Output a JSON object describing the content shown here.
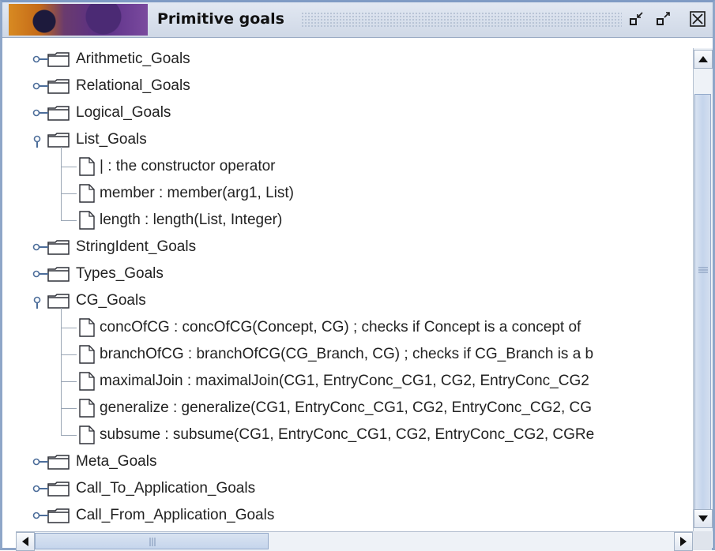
{
  "window": {
    "title": "Primitive goals"
  },
  "colors": {
    "folder_outline": "#2f3138",
    "tree_line": "#9aa6b5",
    "scroll_thumb": "#c5d5ec"
  },
  "tree": {
    "root_items": [
      {
        "label": "Arithmetic_Goals",
        "icon": "folder-icon",
        "expanded": false
      },
      {
        "label": "Relational_Goals",
        "icon": "folder-icon",
        "expanded": false
      },
      {
        "label": "Logical_Goals",
        "icon": "folder-icon",
        "expanded": false
      },
      {
        "label": "List_Goals",
        "icon": "folder-icon",
        "expanded": true,
        "children": [
          {
            "label": "| : the constructor operator",
            "icon": "document-icon"
          },
          {
            "label": "member : member(arg1, List)",
            "icon": "document-icon"
          },
          {
            "label": "length : length(List, Integer)",
            "icon": "document-icon"
          }
        ]
      },
      {
        "label": "StringIdent_Goals",
        "icon": "folder-icon",
        "expanded": false
      },
      {
        "label": "Types_Goals",
        "icon": "folder-icon",
        "expanded": false
      },
      {
        "label": "CG_Goals",
        "icon": "folder-icon",
        "expanded": true,
        "children": [
          {
            "label": "concOfCG : concOfCG(Concept, CG) ; checks if Concept is a concept of",
            "icon": "document-icon"
          },
          {
            "label": "branchOfCG : branchOfCG(CG_Branch, CG) ; checks if CG_Branch is a b",
            "icon": "document-icon"
          },
          {
            "label": "maximalJoin : maximalJoin(CG1, EntryConc_CG1, CG2, EntryConc_CG2",
            "icon": "document-icon"
          },
          {
            "label": "generalize : generalize(CG1, EntryConc_CG1, CG2, EntryConc_CG2, CG",
            "icon": "document-icon"
          },
          {
            "label": "subsume : subsume(CG1, EntryConc_CG1, CG2, EntryConc_CG2, CGRe",
            "icon": "document-icon"
          }
        ]
      },
      {
        "label": "Meta_Goals",
        "icon": "folder-icon",
        "expanded": false
      },
      {
        "label": "Call_To_Application_Goals",
        "icon": "folder-icon",
        "expanded": false
      },
      {
        "label": "Call_From_Application_Goals",
        "icon": "folder-icon",
        "expanded": false
      }
    ]
  }
}
